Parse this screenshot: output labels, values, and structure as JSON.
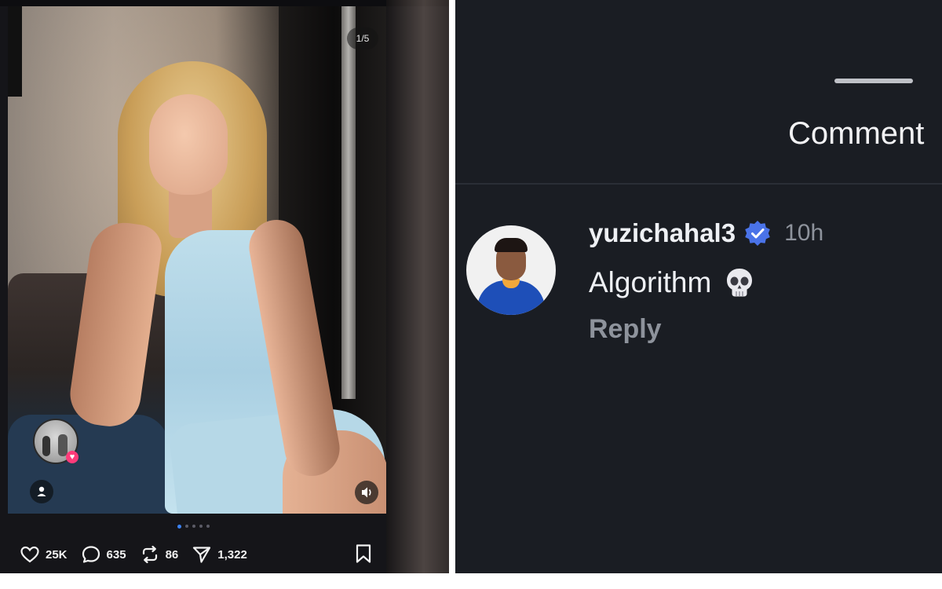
{
  "post": {
    "image_counter": "1/5",
    "carousel": {
      "total": 5,
      "active_index": 0
    },
    "actions": {
      "likes": "25K",
      "comments": "635",
      "reposts": "86",
      "shares": "1,322"
    },
    "icons": {
      "like": "heart-outline-icon",
      "comment": "speech-bubble-icon",
      "repost": "repost-arrows-icon",
      "share": "paper-plane-icon",
      "bookmark": "bookmark-icon",
      "sound": "speaker-icon",
      "user": "person-icon"
    },
    "accent_color": "#3b82f6",
    "heart_badge_color": "#ff3b7a"
  },
  "comments_sheet": {
    "title": "Comment",
    "comment": {
      "username": "yuzichahal3",
      "verified": true,
      "time": "10h",
      "text": "Algorithm",
      "emoji": "skull-icon",
      "reply_label": "Reply"
    },
    "verified_color": "#3b82f6"
  }
}
